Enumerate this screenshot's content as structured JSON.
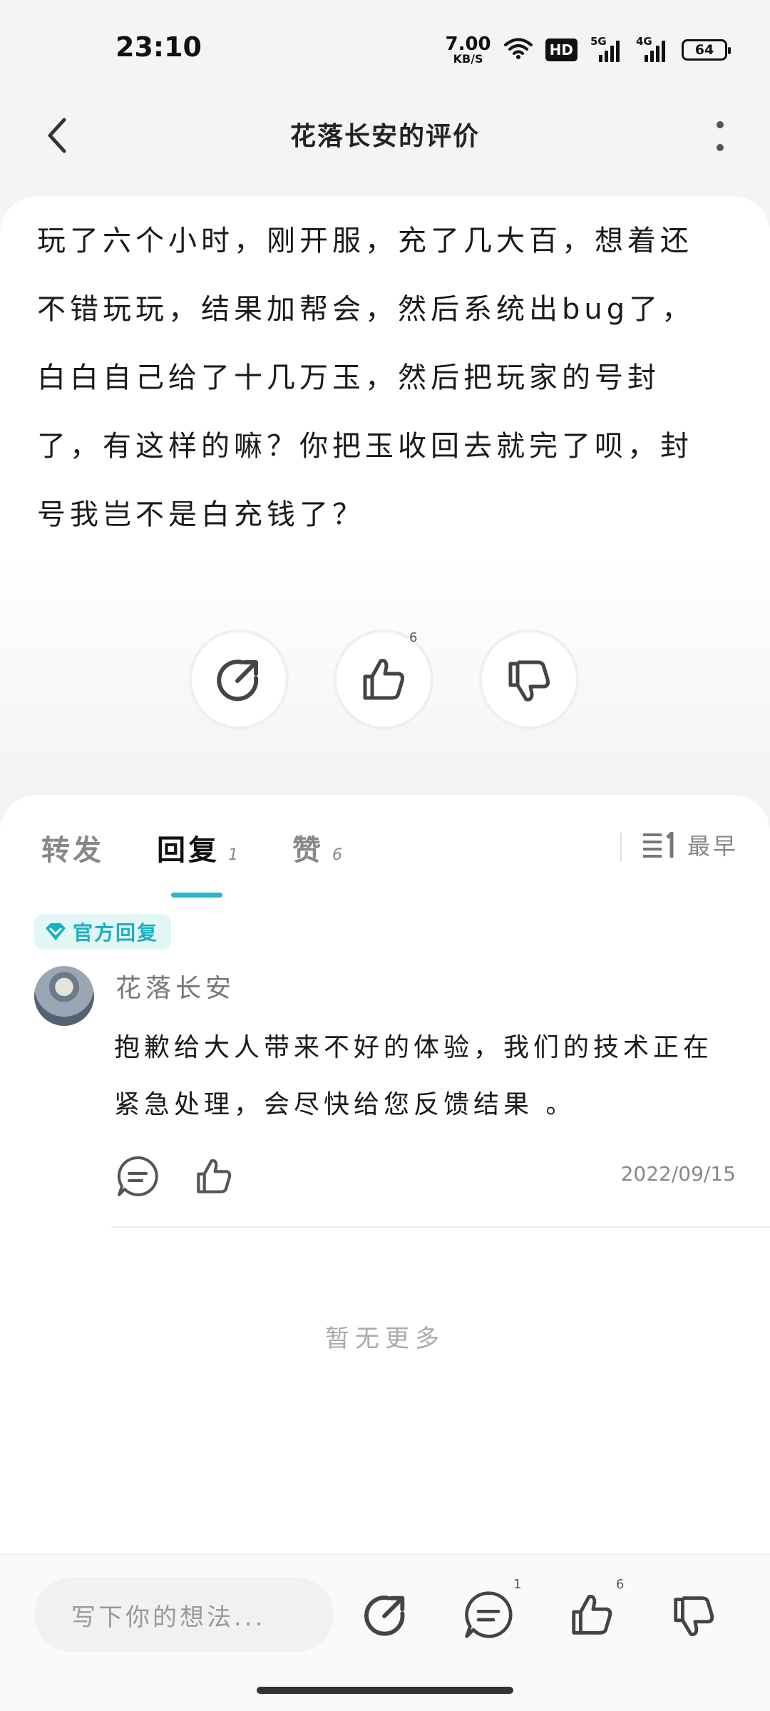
{
  "status": {
    "time": "23:10",
    "net_speed_value": "7.00",
    "net_speed_unit": "KB/S",
    "hd_label": "HD",
    "sig1_label": "5G",
    "sig2_label": "4G",
    "battery": "64"
  },
  "nav": {
    "title": "花落长安的评价"
  },
  "post": {
    "text": "玩了六个小时，刚开服，充了几大百，想着还不错玩玩，结果加帮会，然后系统出bug了，白白自己给了十几万玉，然后把玩家的号封了，有这样的嘛？你把玉收回去就完了呗，封号我岂不是白充钱了？",
    "like_count": "6"
  },
  "tabs": {
    "forward": "转发",
    "reply": "回复",
    "reply_count": "1",
    "like": "赞",
    "like_count": "6",
    "sort": "最早"
  },
  "reply": {
    "badge": "官方回复",
    "author": "花落长安",
    "text": "抱歉给大人带来不好的体验，我们的技术正在紧急处理，会尽快给您反馈结果 。",
    "date": "2022/09/15"
  },
  "footer": {
    "no_more": "暂无更多",
    "input_placeholder": "写下你的想法...",
    "comment_count": "1",
    "like_count": "6"
  }
}
